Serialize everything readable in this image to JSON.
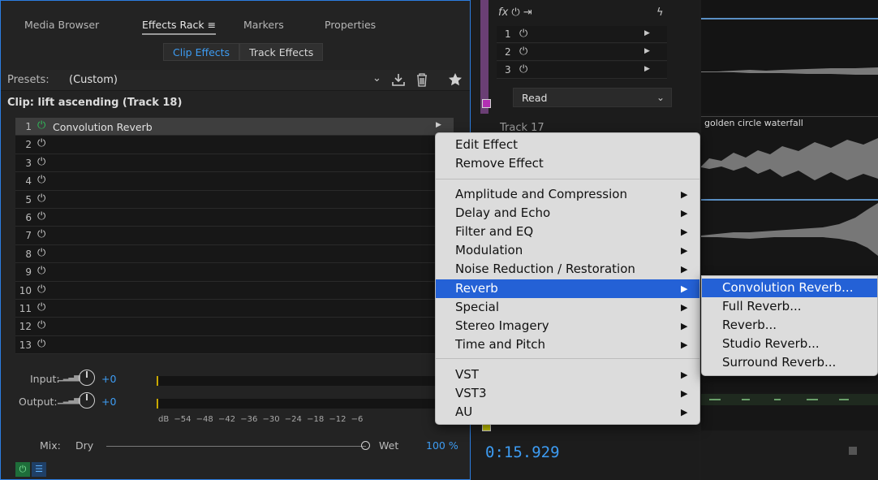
{
  "tabs": {
    "media_browser": "Media Browser",
    "effects_rack": "Effects Rack",
    "effects_menu_glyph": "≡",
    "markers": "Markers",
    "properties": "Properties"
  },
  "segments": {
    "clip_effects": "Clip Effects",
    "track_effects": "Track Effects"
  },
  "presets": {
    "label": "Presets:",
    "value": "(Custom)",
    "dropdown_glyph": "⌄"
  },
  "clip_label": "Clip: lift ascending (Track 18)",
  "slots": [
    {
      "num": "1",
      "name": "Convolution Reverb",
      "on": true
    },
    {
      "num": "2",
      "name": "",
      "on": false
    },
    {
      "num": "3",
      "name": "",
      "on": false
    },
    {
      "num": "4",
      "name": "",
      "on": false
    },
    {
      "num": "5",
      "name": "",
      "on": false
    },
    {
      "num": "6",
      "name": "",
      "on": false
    },
    {
      "num": "7",
      "name": "",
      "on": false
    },
    {
      "num": "8",
      "name": "",
      "on": false
    },
    {
      "num": "9",
      "name": "",
      "on": false
    },
    {
      "num": "10",
      "name": "",
      "on": false
    },
    {
      "num": "11",
      "name": "",
      "on": false
    },
    {
      "num": "12",
      "name": "",
      "on": false
    },
    {
      "num": "13",
      "name": "",
      "on": false
    }
  ],
  "io": {
    "input_label": "Input:",
    "input_value": "+0",
    "output_label": "Output:",
    "output_value": "+0",
    "scale": "dB −54 −48 −42 −36 −30 −24 −18 −12 −6"
  },
  "mix": {
    "label": "Mix:",
    "dry": "Dry",
    "wet": "Wet",
    "percent": "100 %",
    "level": 1.0
  },
  "mixer": {
    "fx_slots": [
      "1",
      "2",
      "3"
    ],
    "read_mode": "Read",
    "track_header": "Track 17",
    "time": "0:15.929"
  },
  "waveform": {
    "clip_name": "golden circle waterfall"
  },
  "context_menu": {
    "edit_effect": "Edit Effect",
    "remove_effect": "Remove Effect",
    "categories": [
      "Amplitude and Compression",
      "Delay and Echo",
      "Filter and EQ",
      "Modulation",
      "Noise Reduction / Restoration",
      "Reverb",
      "Special",
      "Stereo Imagery",
      "Time and Pitch"
    ],
    "highlighted": "Reverb",
    "plugins": [
      "VST",
      "VST3",
      "AU"
    ]
  },
  "submenu": {
    "items": [
      "Convolution Reverb...",
      "Full Reverb...",
      "Reverb...",
      "Studio Reverb...",
      "Surround Reverb..."
    ],
    "highlighted": "Convolution Reverb..."
  },
  "colors": {
    "accent_blue": "#3d9cf3",
    "menu_highlight": "#2461d6",
    "power_on_green": "#2fbf5a",
    "panel_border": "#2b7de0"
  }
}
